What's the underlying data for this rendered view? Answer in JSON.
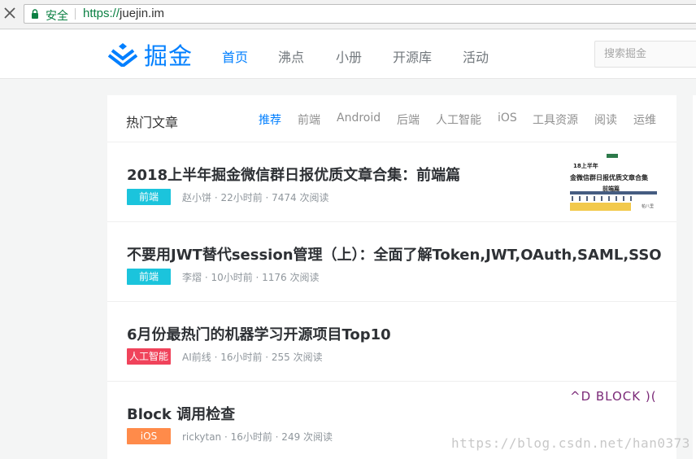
{
  "browser": {
    "secure_label": "安全",
    "url_scheme": "https://",
    "url_host": "juejin.im"
  },
  "header": {
    "logo_text": "掘金",
    "nav": [
      "首页",
      "沸点",
      "小册",
      "开源库",
      "活动"
    ],
    "active_nav": "首页",
    "search_placeholder": "搜索掘金"
  },
  "feed": {
    "title": "热门文章",
    "categories": [
      "推荐",
      "前端",
      "Android",
      "后端",
      "人工智能",
      "iOS",
      "工具资源",
      "阅读",
      "运维"
    ],
    "active_category": "推荐",
    "articles": [
      {
        "title": "2018上半年掘金微信群日报优质文章合集：前端篇",
        "tag": "前端",
        "tag_color": "#1bc4dc",
        "meta": "赵小饼 · 22小时前 · 7474 次阅读",
        "thumb_lines": [
          "18上半年",
          "金微信群日报优质文章合集",
          "前端篇",
          "帕八里"
        ]
      },
      {
        "title": "不要用JWT替代session管理（上）：全面了解Token,JWT,OAuth,SAML,SSO",
        "tag": "前端",
        "tag_color": "#1bc4dc",
        "meta": "李熠 · 10小时前 · 1176 次阅读"
      },
      {
        "title": "6月份最热门的机器学习开源项目Top10",
        "tag": "人工智能",
        "tag_color": "#f0435b",
        "meta": "AI前线 · 16小时前 · 255 次阅读"
      },
      {
        "title": "Block 调用检查",
        "tag": "iOS",
        "tag_color": "#ff8b4a",
        "meta": "rickytan · 16小时前 · 249 次阅读",
        "thumb_text": "^D BLOCK )("
      }
    ]
  },
  "watermark": "https://blog.csdn.net/han0373",
  "colors": {
    "brand": "#007fff",
    "secure_green": "#0b8043"
  }
}
